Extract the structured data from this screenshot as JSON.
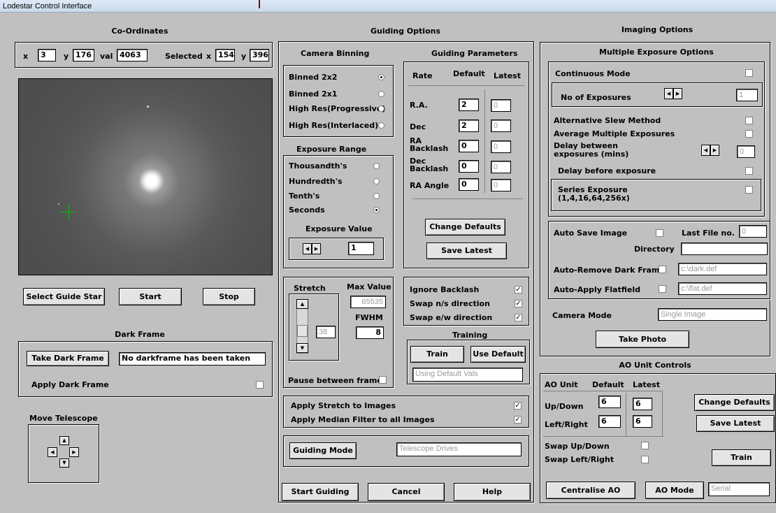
{
  "window": {
    "title": "Lodestar Control Interface"
  },
  "headers": {
    "coordinates": "Co-Ordinates",
    "guiding_options": "Guiding Options",
    "imaging_options": "Imaging Options",
    "dark_frame": "Dark Frame",
    "move_telescope": "Move Telescope",
    "ao_unit_controls": "AO Unit Controls"
  },
  "coords": {
    "x_label": "x",
    "x_value": "3",
    "y_label": "y",
    "y_value": "176",
    "val_label": "val",
    "val_value": "4063",
    "selected_label": "Selected",
    "sel_x_label": "x",
    "sel_x_value": "154",
    "sel_y_label": "y",
    "sel_y_value": "396"
  },
  "guide_buttons": {
    "select": "Select Guide Star",
    "start": "Start",
    "stop": "Stop"
  },
  "dark_frame": {
    "take_button": "Take Dark Frame",
    "status": "No darkframe has been taken",
    "apply_label": "Apply Dark Frame"
  },
  "binning": {
    "title": "Camera Binning",
    "options": [
      {
        "label": "Binned 2x2",
        "selected": true
      },
      {
        "label": "Binned 2x1",
        "selected": false
      },
      {
        "label": "High Res(Progressive)",
        "selected": false
      },
      {
        "label": "High Res(Interlaced)",
        "selected": false
      }
    ]
  },
  "exposure_range": {
    "title": "Exposure Range",
    "options": [
      {
        "label": "Thousandth's",
        "selected": false
      },
      {
        "label": "Hundredth's",
        "selected": false
      },
      {
        "label": "Tenth's",
        "selected": false
      },
      {
        "label": "Seconds",
        "selected": true
      }
    ],
    "value_label": "Exposure Value",
    "value": "1"
  },
  "guiding_params": {
    "title": "Guiding Parameters",
    "col_rate": "Rate",
    "col_default": "Default",
    "col_latest": "Latest",
    "rows": [
      {
        "label": "R.A.",
        "default": "2",
        "latest": "0"
      },
      {
        "label": "Dec",
        "default": "2",
        "latest": "0"
      },
      {
        "label": "RA Backlash",
        "default": "0",
        "latest": "0"
      },
      {
        "label": "Dec Backlash",
        "default": "0",
        "latest": "0"
      },
      {
        "label": "RA Angle",
        "default": "0",
        "latest": "0"
      }
    ],
    "change_defaults": "Change Defaults",
    "save_latest": "Save Latest"
  },
  "stretch": {
    "title": "Stretch",
    "max_value_label": "Max Value",
    "max_value": "65535",
    "value": "38",
    "fwhm_label": "FWHM",
    "fwhm": "8",
    "pause_label": "Pause between frames"
  },
  "backlash": {
    "items": [
      {
        "label": "Ignore Backlash",
        "checked": true
      },
      {
        "label": "Swap n/s direction",
        "checked": true
      },
      {
        "label": "Swap e/w direction",
        "checked": true
      }
    ]
  },
  "training": {
    "title": "Training",
    "train": "Train",
    "use_default": "Use Default",
    "status": "Using Default Vals"
  },
  "apply_opts": {
    "stretch": "Apply Stretch to Images",
    "stretch_checked": true,
    "median": "Apply Median Filter to all Images",
    "median_checked": true
  },
  "guiding_mode": {
    "button": "Guiding Mode",
    "value": "Telescope Drives"
  },
  "bottom_buttons": {
    "start": "Start Guiding",
    "cancel": "Cancel",
    "help": "Help"
  },
  "multi_exposure": {
    "title": "Multiple Exposure Options",
    "continuous": "Continuous Mode",
    "no_exposures_label": "No of Exposures",
    "no_exposures": "1",
    "alt_slew": "Alternative Slew Method",
    "avg_multiple": "Average Multiple Exposures",
    "delay_between": "Delay between exposures (mins)",
    "delay_value": "0",
    "delay_before": "Delay before exposure",
    "series": "Series Exposure (1,4,16,64,256x)"
  },
  "autosave": {
    "auto_save": "Auto Save Image",
    "last_file_label": "Last File no.",
    "last_file": "0",
    "directory_label": "Directory",
    "directory": "",
    "auto_dark": "Auto-Remove Dark Frame",
    "dark_file": "c:\\dark.def",
    "auto_flat": "Auto-Apply Flatfield",
    "flat_file": "c:\\flat.def"
  },
  "camera": {
    "mode_label": "Camera Mode",
    "mode_value": "Single Image",
    "take_photo": "Take Photo"
  },
  "ao": {
    "col_unit": "AO Unit",
    "col_default": "Default",
    "col_latest": "Latest",
    "rows": [
      {
        "label": "Up/Down",
        "default": "6",
        "latest": "6"
      },
      {
        "label": "Left/Right",
        "default": "6",
        "latest": "6"
      }
    ],
    "change_defaults": "Change Defaults",
    "save_latest": "Save Latest",
    "swap_ud": "Swap Up/Down",
    "swap_lr": "Swap Left/Right",
    "train": "Train",
    "centralise": "Centralise AO",
    "mode_button": "AO Mode",
    "mode_value": "Serial"
  }
}
